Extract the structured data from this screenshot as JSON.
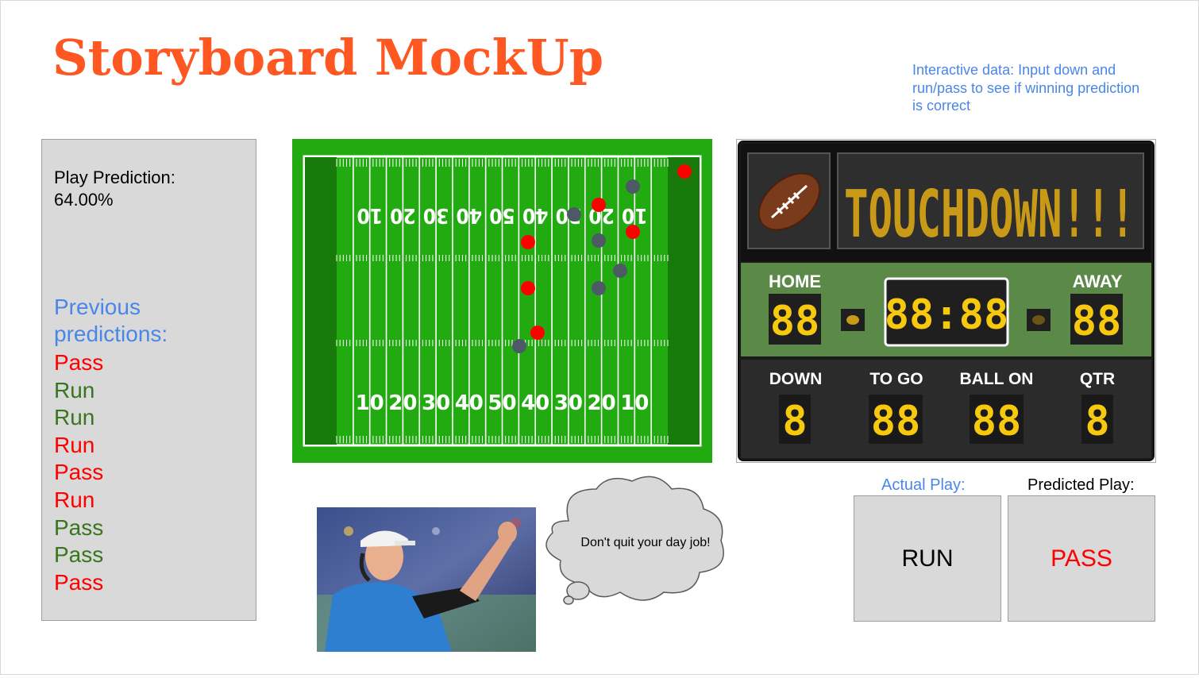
{
  "slide": {
    "title": "Storyboard MockUp",
    "note": "Interactive data: Input down and run/pass to see if winning prediction is correct"
  },
  "prediction_panel": {
    "label_line1": "Play Prediction:",
    "label_line2": "64.00%",
    "previous_title": "Previous predictions:",
    "previous": [
      {
        "text": "Pass",
        "color": "#ff0000"
      },
      {
        "text": "Run",
        "color": "#38761d"
      },
      {
        "text": "Run",
        "color": "#38761d"
      },
      {
        "text": "Run",
        "color": "#ff0000"
      },
      {
        "text": "Pass",
        "color": "#ff0000"
      },
      {
        "text": "Run",
        "color": "#ff0000"
      },
      {
        "text": "Pass",
        "color": "#38761d"
      },
      {
        "text": "Pass",
        "color": "#38761d"
      },
      {
        "text": "Pass",
        "color": "#ff0000"
      }
    ]
  },
  "field": {
    "top_numbers": [
      "10",
      "20",
      "30",
      "40",
      "50",
      "40",
      "30",
      "20",
      "10"
    ],
    "bottom_numbers": [
      "10",
      "20",
      "30",
      "40",
      "50",
      "40",
      "30",
      "20",
      "10"
    ],
    "colors": {
      "grass": "#22aa11",
      "endzone": "#197a0c",
      "offense": "#ff0000",
      "defense": "#4d5a66"
    }
  },
  "scoreboard": {
    "banner": "TOUCHDOWN!!!",
    "home_label": "HOME",
    "away_label": "AWAY",
    "home_score": "88",
    "away_score": "88",
    "clock": "88:88",
    "down_label": "DOWN",
    "togo_label": "TO GO",
    "ballon_label": "BALL ON",
    "qtr_label": "QTR",
    "down": "8",
    "togo": "88",
    "ballon": "88",
    "qtr": "8",
    "colors": {
      "digit": "#f6c90e",
      "green_panel": "#5b8a48",
      "dark_panel": "#2b2b2b"
    }
  },
  "bubble_text": "Don't quit your day job!",
  "actual_play": {
    "label": "Actual Play:",
    "value": "RUN",
    "label_color": "#4a86e8",
    "value_color": "#000000"
  },
  "predicted_play": {
    "label": "Predicted Play:",
    "value": "PASS",
    "label_color": "#000000",
    "value_color": "#ff0000"
  }
}
